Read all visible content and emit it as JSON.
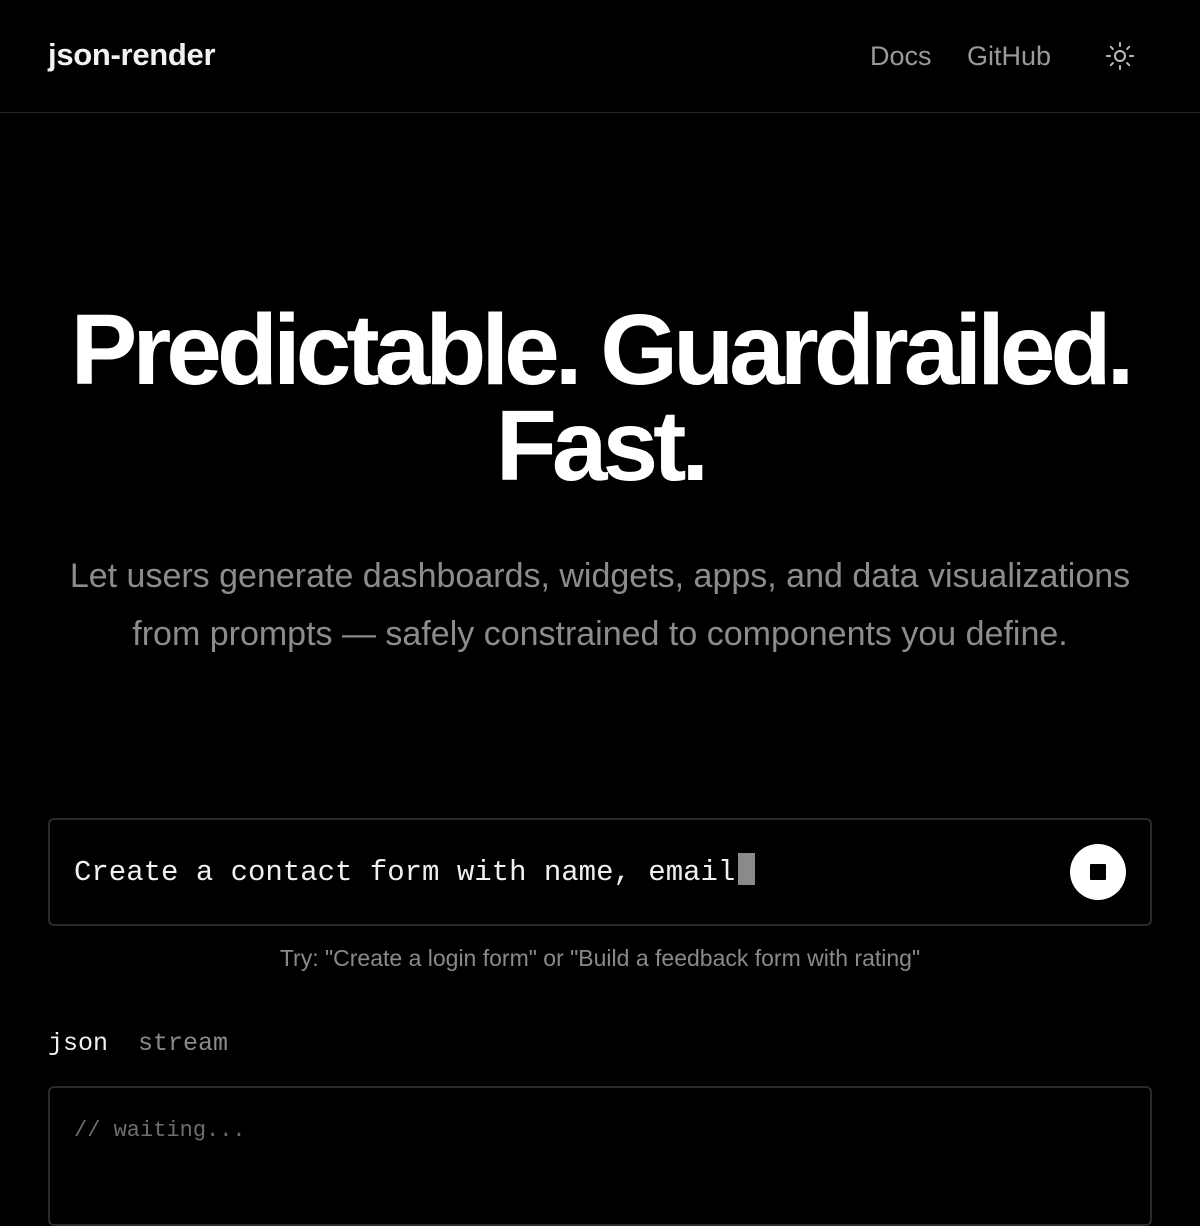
{
  "header": {
    "brand": "json-render",
    "nav": {
      "docs": "Docs",
      "github": "GitHub"
    },
    "theme_toggle_icon": "sun-icon"
  },
  "hero": {
    "title_line1": "Predictable. Guardrailed.",
    "title_line2": "Fast.",
    "subtitle": "Let users generate dashboards, widgets, apps, and data visualizations from prompts — safely constrained to components you define."
  },
  "prompt": {
    "value": "Create a contact form with name, email",
    "stop_icon": "stop-icon",
    "hint": "Try: \"Create a login form\" or \"Build a feedback form with rating\""
  },
  "output": {
    "tabs": [
      {
        "label": "json",
        "active": true
      },
      {
        "label": "stream",
        "active": false
      }
    ],
    "placeholder": "// waiting..."
  },
  "colors": {
    "background": "#000000",
    "text_primary": "#ffffff",
    "text_muted": "#8c8c8c",
    "border": "#2a2a2a"
  }
}
